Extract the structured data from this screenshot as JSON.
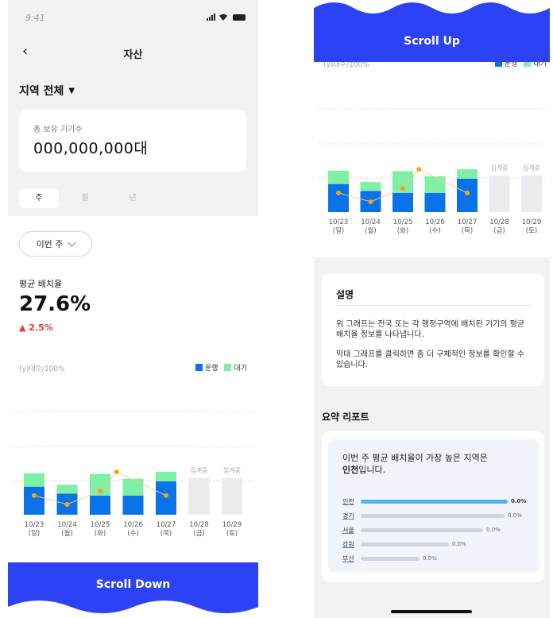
{
  "status": {
    "time": "9:41"
  },
  "nav": {
    "title": "자산"
  },
  "region": {
    "label": "지역 전체",
    "caret": "▼"
  },
  "device_card": {
    "label": "총 보유 기기수",
    "value": "000,000,000대"
  },
  "tabs": [
    {
      "label": "주",
      "active": true
    },
    {
      "label": "월",
      "active": false
    },
    {
      "label": "년",
      "active": false
    }
  ],
  "period": {
    "label": "이번 주"
  },
  "average": {
    "label": "평균 배치율",
    "value": "27.6%",
    "change": "▲ 2.5%"
  },
  "colors": {
    "operating": "#0a73ea",
    "standby": "#7df0a4",
    "pending": "#e9ebee",
    "line": "#f7a21b",
    "accent": "#2c43f5",
    "change_up": "#e53935"
  },
  "chart_data": {
    "type": "bar",
    "ylabel": "(y)대수/100%",
    "categories": [
      "10/23\n(일)",
      "10/24\n(월)",
      "10/25\n(화)",
      "10/26\n(수)",
      "10/27\n(목)",
      "10/28\n(금)",
      "10/29\n(토)"
    ],
    "series": [
      {
        "name": "운행",
        "values": [
          57,
          43,
          39,
          39,
          68,
          null,
          null
        ]
      },
      {
        "name": "대기",
        "values": [
          27,
          18,
          44,
          34,
          19,
          null,
          null
        ]
      }
    ],
    "line_values": [
      39,
      21,
      48,
      null,
      39,
      null,
      null
    ],
    "line_peak": 87,
    "pending_label": "집계중",
    "legend_position": "top-right",
    "ylim": [
      0,
      100
    ]
  },
  "buttons": {
    "scroll_down": "Scroll Down",
    "scroll_up": "Scroll Up"
  },
  "description": {
    "title": "설명",
    "para1": "위 그래프는 전국 또는 각 행정구역에 배치된 기기의 평균 배치율 정보를 나타냅니다.",
    "para2": "막대 그래프를 클릭하면 좀 더 구체적인 정보를 확인할 수 있습니다."
  },
  "summary": {
    "title": "요약 리포트",
    "text_prefix": "이번 주 평균 배치율이 가장 높은 지역은",
    "text_region": "인천",
    "text_suffix": "입니다.",
    "ranking": [
      {
        "name": "인천",
        "value": "0.0%",
        "fill": 1.0,
        "color": "#52b3f5"
      },
      {
        "name": "경기",
        "value": "0.0%",
        "fill": 0.98,
        "color": "#cfd3da"
      },
      {
        "name": "서울",
        "value": "0.0%",
        "fill": 0.83,
        "color": "#cfd3da"
      },
      {
        "name": "강원",
        "value": "0.0%",
        "fill": 0.6,
        "color": "#cfd3da"
      },
      {
        "name": "부산",
        "value": "0.0%",
        "fill": 0.4,
        "color": "#cfd3da"
      }
    ]
  }
}
